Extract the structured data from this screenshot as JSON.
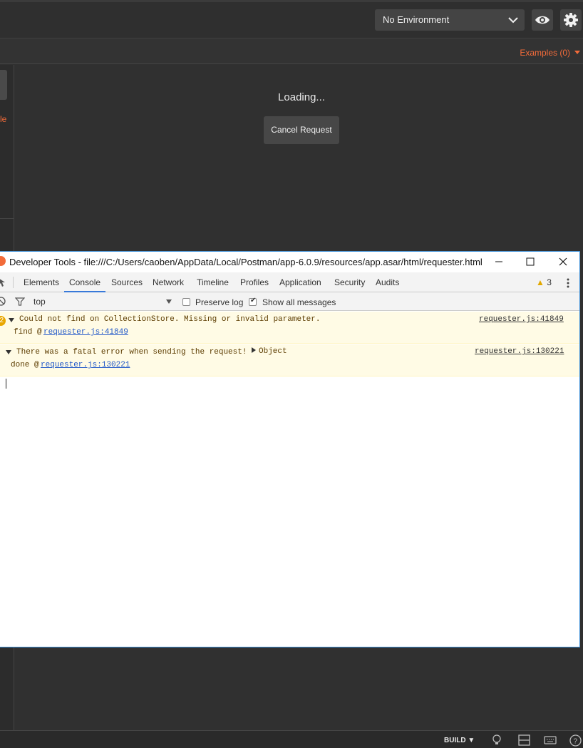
{
  "header": {
    "environment": "No Environment"
  },
  "subbar": {
    "examples_label": "Examples (0)"
  },
  "left_pane": {
    "orange_stub": "le"
  },
  "response": {
    "loading_text": "Loading...",
    "cancel_label": "Cancel Request"
  },
  "devtools": {
    "title": "Developer Tools - file:///C:/Users/caoben/AppData/Local/Postman/app-6.0.9/resources/app.asar/html/requester.html",
    "tabs": [
      "Elements",
      "Console",
      "Sources",
      "Network",
      "Timeline",
      "Profiles",
      "Application",
      "Security",
      "Audits"
    ],
    "active_tab": "Console",
    "warning_count": "3",
    "toolbar": {
      "context": "top",
      "preserve_log": "Preserve log",
      "show_all": "Show all messages"
    },
    "messages": [
      {
        "count": "2",
        "text": "Could not find on CollectionStore. Missing or invalid parameter.",
        "source": "requester.js:41849",
        "trace_fn": "find @",
        "trace_link": "requester.js:41849"
      },
      {
        "text": "There was a fatal error when sending the request!",
        "object_label": "Object",
        "source": "requester.js:130221",
        "trace_fn": "done @",
        "trace_link": "requester.js:130221"
      }
    ]
  },
  "statusbar": {
    "build_label": "BUILD ▼"
  },
  "colors": {
    "accent": "#f26b3a",
    "tab_underline": "#3879d9",
    "warning_bg": "#fffbe5"
  }
}
